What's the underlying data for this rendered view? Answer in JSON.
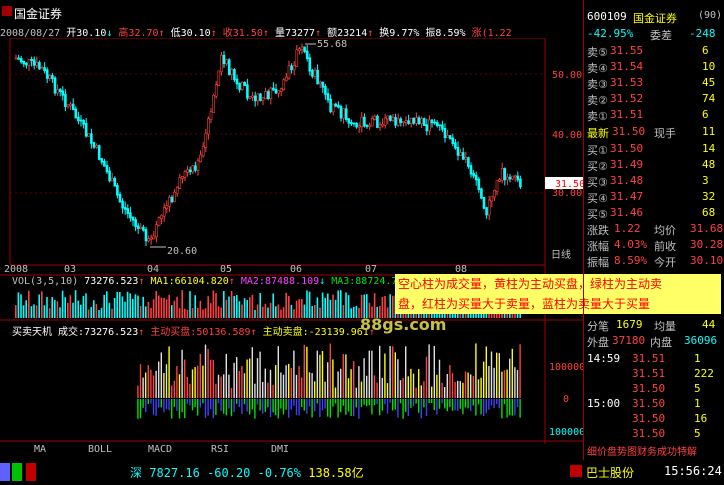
{
  "app": {
    "stock_name": "国金证券",
    "right_code": "600109",
    "right_name": "国金证券",
    "right_code_suffix": "(90)"
  },
  "info_row": {
    "date": "2008/08/27",
    "open_label": "开",
    "open": "30.10",
    "high_label": "高",
    "high": "32.70",
    "low_label": "低",
    "low": "30.10",
    "close_label": "收",
    "close": "31.50",
    "volume_label": "量",
    "volume": "73277",
    "amount_label": "额",
    "amount": "23214",
    "turnover_label": "换",
    "turnover": "9.77%",
    "amplitude_label": "振",
    "amplitude": "8.59%",
    "change_label": "涨",
    "change": "(1.22"
  },
  "main_chart": {
    "y_ticks": [
      "50.00",
      "40.00",
      "30.00"
    ],
    "x_ticks": [
      "2008",
      "03",
      "04",
      "05",
      "06",
      "07",
      "08"
    ],
    "x_axis_label": "日线",
    "high_marker": "55.68",
    "low_marker": "20.60",
    "current_price": "31.50"
  },
  "vol_panel": {
    "title": "VOL(3,5,10)",
    "vol": "73276.523",
    "ma1": "MA1:66104.820",
    "ma2": "MA2:87488.109",
    "ma3": "MA3:88724.7"
  },
  "flow_panel": {
    "title": "买卖天机",
    "trade_label": "成交:",
    "trade_value": "73276.523",
    "active_buy": "主动买盘:50136.589",
    "active_sell": "主动卖盘:-23139.961",
    "y_ticks": [
      "100000",
      "0",
      "100000"
    ]
  },
  "tooltip": {
    "line1": "空心柱为成交量，黄柱为主动买盘，绿柱为主动卖",
    "line2": "盘，红柱为买量大于卖量，蓝柱为卖量大于买量"
  },
  "watermark": "88gs.com",
  "right_panel": {
    "weibi_label": "委比",
    "weibi_value": "-42.95%",
    "weicha_label": "委差",
    "weicha_value": "-248",
    "sell": [
      {
        "label": "卖⑤",
        "price": "31.55",
        "vol": "6"
      },
      {
        "label": "卖④",
        "price": "31.54",
        "vol": "10"
      },
      {
        "label": "卖③",
        "price": "31.53",
        "vol": "45"
      },
      {
        "label": "卖②",
        "price": "31.52",
        "vol": "74"
      },
      {
        "label": "卖①",
        "price": "31.51",
        "vol": "6"
      }
    ],
    "latest_label": "最新",
    "latest_value": "31.50",
    "hand_label": "现手",
    "hand_value": "11",
    "buy": [
      {
        "label": "买①",
        "price": "31.50",
        "vol": "14"
      },
      {
        "label": "买②",
        "price": "31.49",
        "vol": "48"
      },
      {
        "label": "买③",
        "price": "31.48",
        "vol": "3"
      },
      {
        "label": "买④",
        "price": "31.47",
        "vol": "32"
      },
      {
        "label": "买⑤",
        "price": "31.46",
        "vol": "68"
      }
    ],
    "stats": [
      {
        "l1": "涨跌",
        "v1": "1.22",
        "l2": "均价",
        "v2": "31.68"
      },
      {
        "l1": "涨幅",
        "v1": "4.03%",
        "l2": "前收",
        "v2": "30.28"
      },
      {
        "l1": "振幅",
        "v1": "8.59%",
        "l2": "今开",
        "v2": "30.10"
      }
    ],
    "fenbi_label": "分笔",
    "fenbi_value": "1679",
    "junliang_label": "均量",
    "junliang_value": "44",
    "waipan_label": "外盘",
    "waipan_value": "37180",
    "neipan_label": "内盘",
    "neipan_value": "36096",
    "ticks": [
      {
        "time": "14:59",
        "price": "31.51",
        "vol": "1"
      },
      {
        "time": "",
        "price": "31.51",
        "vol": "222"
      },
      {
        "time": "",
        "price": "31.50",
        "vol": "5"
      },
      {
        "time": "15:00",
        "price": "31.50",
        "vol": "1"
      },
      {
        "time": "",
        "price": "31.50",
        "vol": "16"
      },
      {
        "time": "",
        "price": "31.50",
        "vol": "5"
      }
    ],
    "bottom_tabs": "细价盘势图财务成功特解"
  },
  "bottom_tabs": [
    "MA",
    "BOLL",
    "MACD",
    "RSI",
    "DMI"
  ],
  "statusbar": {
    "market": "深",
    "index": "7827.16",
    "change": "-60.20",
    "pct": "-0.76%",
    "amount": "138.58亿",
    "stock": "巴士股份",
    "time": "15:56:24"
  },
  "colors": {
    "up": "#ff4040",
    "down": "#00ffff",
    "grid": "#a00000",
    "tooltip_bg": "#ffff66"
  }
}
